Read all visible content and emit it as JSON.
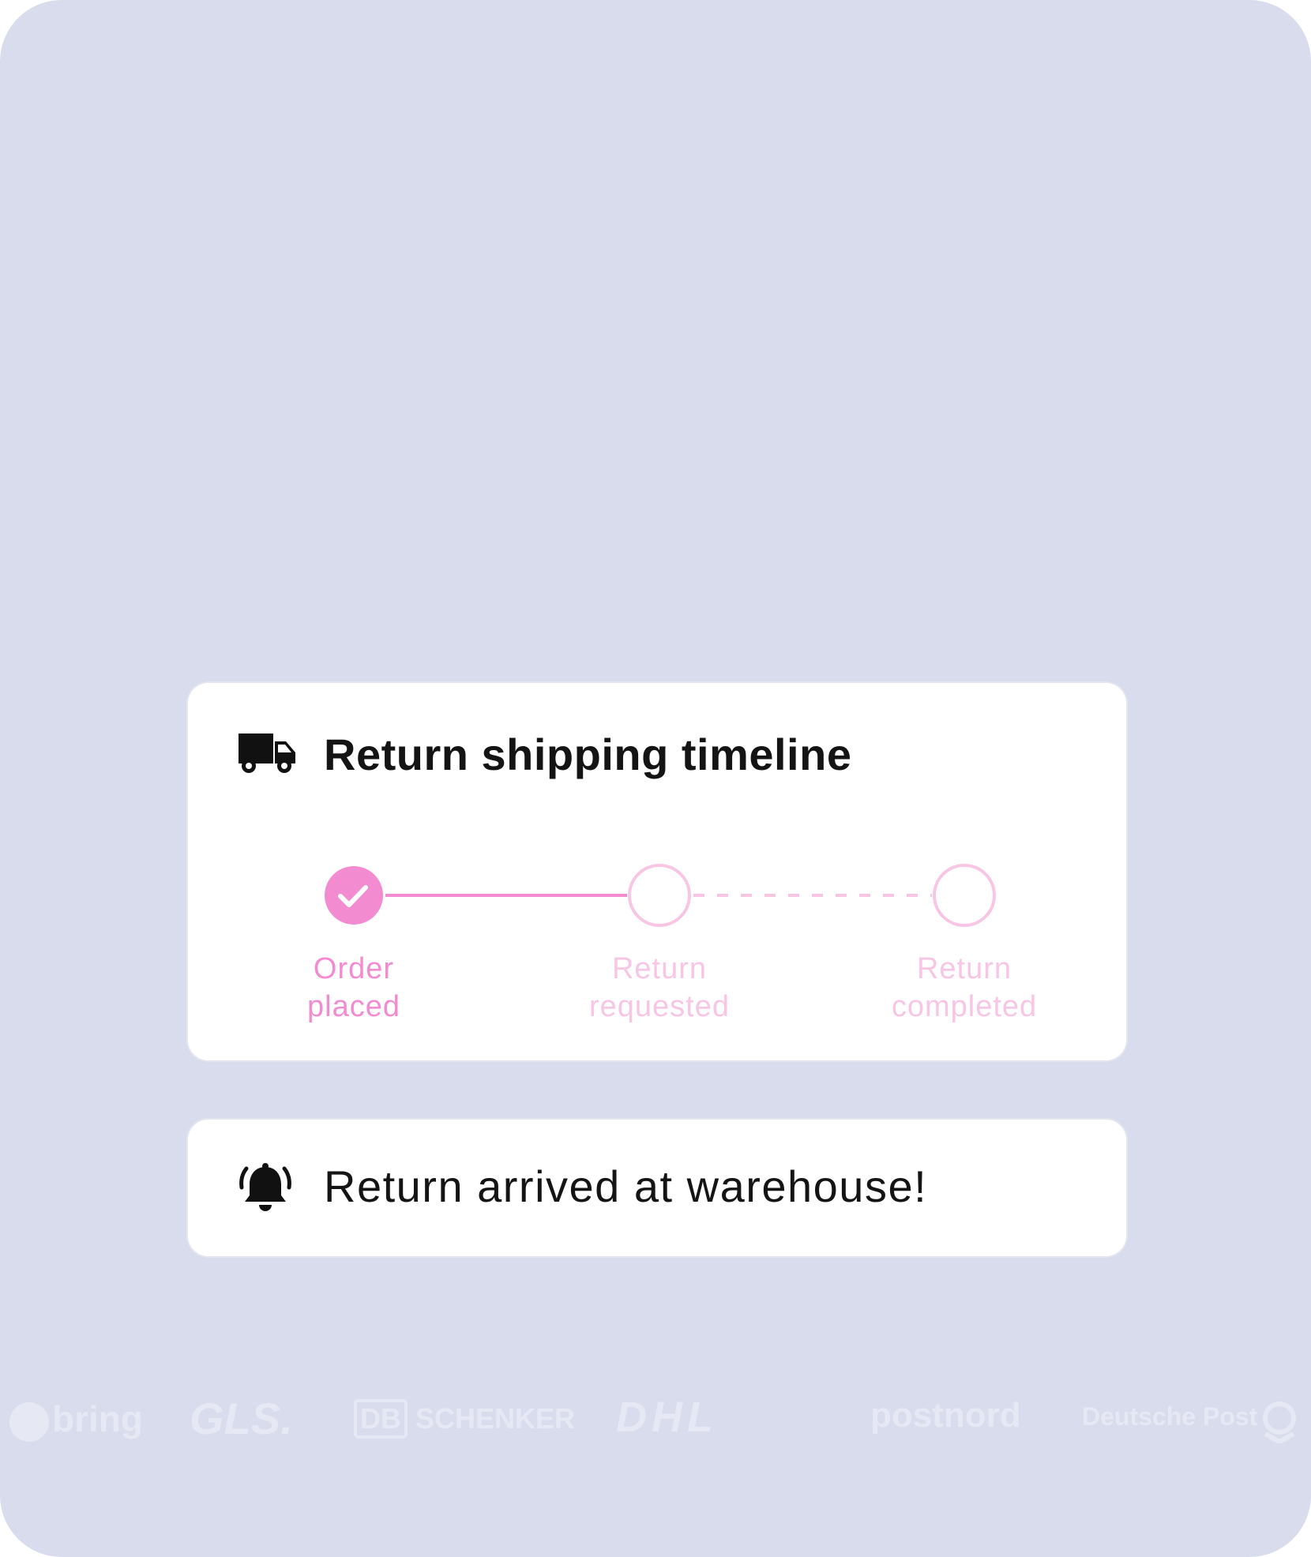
{
  "timeline_card": {
    "title": "Return shipping timeline",
    "icon": "truck-icon",
    "steps": [
      {
        "label_line1": "Order",
        "label_line2": "placed",
        "status": "completed"
      },
      {
        "label_line1": "Return",
        "label_line2": "requested",
        "status": "pending"
      },
      {
        "label_line1": "Return",
        "label_line2": "completed",
        "status": "pending"
      }
    ]
  },
  "alert_card": {
    "icon": "bell-ringing-icon",
    "message": "Return arrived at warehouse!"
  },
  "carriers": [
    {
      "name": "bring"
    },
    {
      "name": "GLS."
    },
    {
      "name": "DB",
      "suffix": "SCHENKER"
    },
    {
      "name": "DHL"
    },
    {
      "name": "postnord"
    },
    {
      "name": "Deutsche Post"
    }
  ],
  "colors": {
    "background": "#d8dced",
    "card": "#ffffff",
    "accent": "#f38bd1",
    "accent_light": "#f8c6e4",
    "text": "#141414",
    "logo": "#e6e9f4"
  }
}
